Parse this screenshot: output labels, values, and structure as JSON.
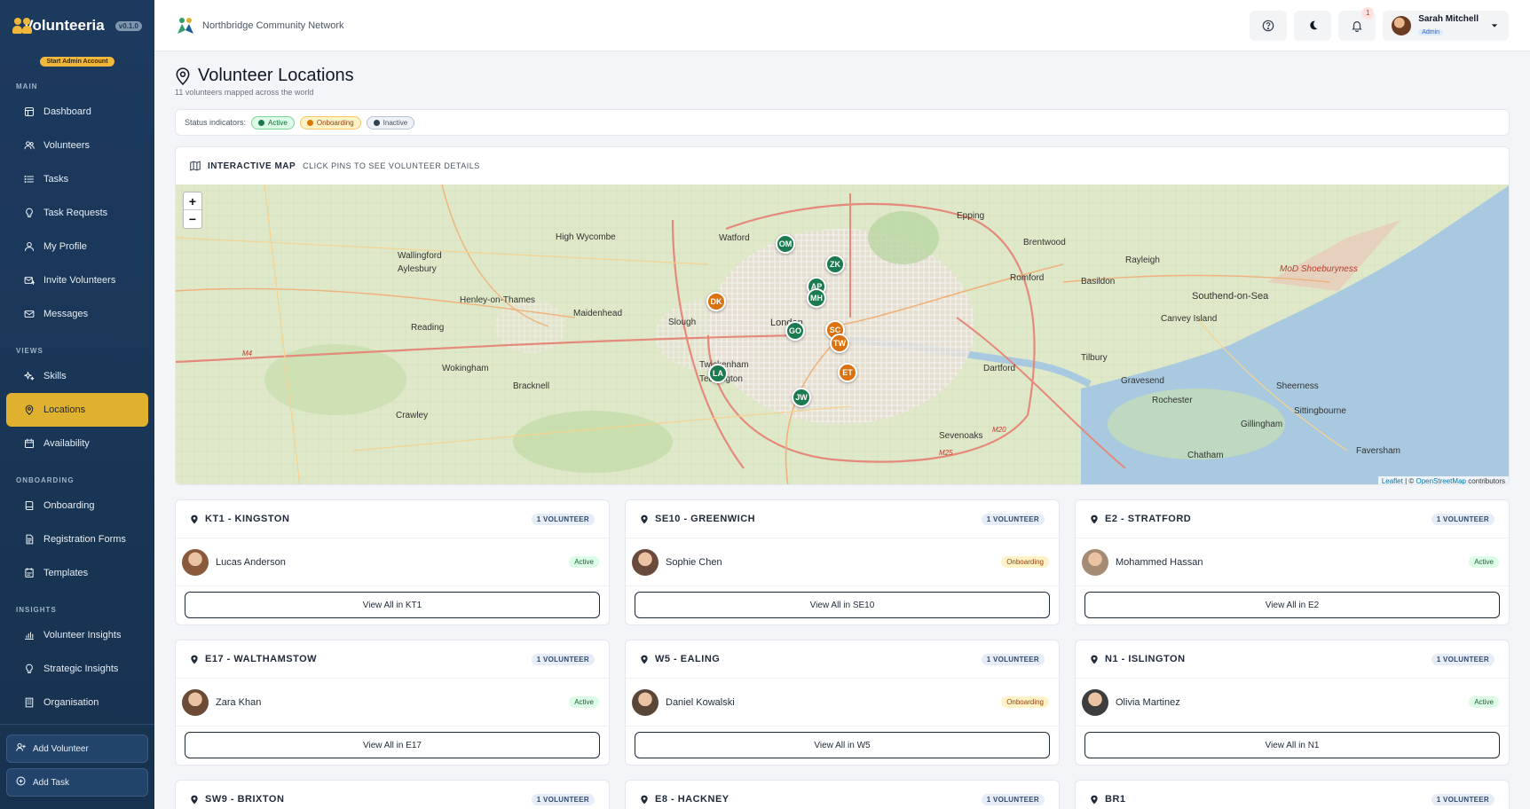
{
  "app": {
    "name": "Volunteeria",
    "version": "v0.1.0",
    "admin_pill": "Start Admin Account",
    "org_name": "Northbridge Community Network"
  },
  "sidebar": {
    "sections": [
      {
        "title": "MAIN",
        "items": [
          {
            "label": "Dashboard",
            "icon": "dashboard-icon"
          },
          {
            "label": "Volunteers",
            "icon": "users-icon"
          },
          {
            "label": "Tasks",
            "icon": "list-icon"
          },
          {
            "label": "Task Requests",
            "icon": "lightbulb-icon"
          },
          {
            "label": "My Profile",
            "icon": "user-icon"
          },
          {
            "label": "Invite Volunteers",
            "icon": "mail-plus-icon"
          },
          {
            "label": "Messages",
            "icon": "mail-icon"
          }
        ]
      },
      {
        "title": "VIEWS",
        "items": [
          {
            "label": "Skills",
            "icon": "sparkle-icon"
          },
          {
            "label": "Locations",
            "icon": "map-pin-icon",
            "active": true
          },
          {
            "label": "Availability",
            "icon": "calendar-icon"
          }
        ]
      },
      {
        "title": "ONBOARDING",
        "items": [
          {
            "label": "Onboarding",
            "icon": "book-icon"
          },
          {
            "label": "Registration Forms",
            "icon": "form-icon"
          },
          {
            "label": "Templates",
            "icon": "template-icon"
          }
        ]
      },
      {
        "title": "INSIGHTS",
        "items": [
          {
            "label": "Volunteer Insights",
            "icon": "bar-chart-icon"
          },
          {
            "label": "Strategic Insights",
            "icon": "lightbulb-icon"
          },
          {
            "label": "Organisation",
            "icon": "building-icon"
          }
        ]
      }
    ],
    "actions": {
      "add_volunteer": "Add Volunteer",
      "add_task": "Add Task"
    }
  },
  "header": {
    "notification_count": "1",
    "user_name": "Sarah Mitchell",
    "user_role": "Admin"
  },
  "page": {
    "title": "Volunteer Locations",
    "subtitle": "11 volunteers mapped across the world",
    "status_label": "Status indicators:",
    "status_legend": [
      "Active",
      "Onboarding",
      "Inactive"
    ],
    "map_title": "INTERACTIVE MAP",
    "map_hint": "CLICK PINS TO SEE VOLUNTEER DETAILS",
    "attribution": {
      "leaflet": "Leaflet",
      "sep": " | © ",
      "osm": "OpenStreetMap",
      "rest": " contributors"
    }
  },
  "map_places": [
    "London",
    "Southend-on-Sea",
    "High Wycombe",
    "Maidenhead",
    "Dartford",
    "Gravesend",
    "Epping",
    "Romford",
    "Basildon",
    "Chatham",
    "Bracknell",
    "Wokingham",
    "Reading",
    "Slough",
    "Watford",
    "Crawley",
    "Sevenoaks",
    "Twickenham",
    "Teddington",
    "Tilbury",
    "Canvey Island",
    "Rochester",
    "Sittingbourne",
    "Faversham",
    "Sheerness",
    "Gillingham",
    "Rayleigh",
    "Brentwood",
    "Aylesbury",
    "Wallingford",
    "Henley-on-Thames"
  ],
  "map_special_labels": {
    "mod": "MoD Shoeburyness",
    "m20": "M20",
    "m25": "M25",
    "m4": "M4"
  },
  "pins": [
    {
      "initials": "OM",
      "status": "active"
    },
    {
      "initials": "ZK",
      "status": "active"
    },
    {
      "initials": "AP",
      "status": "active"
    },
    {
      "initials": "MH",
      "status": "active"
    },
    {
      "initials": "DK",
      "status": "onboarding"
    },
    {
      "initials": "GO",
      "status": "active"
    },
    {
      "initials": "SC",
      "status": "onboarding"
    },
    {
      "initials": "TW",
      "status": "onboarding"
    },
    {
      "initials": "ET",
      "status": "onboarding"
    },
    {
      "initials": "LA",
      "status": "active"
    },
    {
      "initials": "JW",
      "status": "active"
    }
  ],
  "locations": [
    {
      "name": "KT1 - KINGSTON",
      "count": "1 VOLUNTEER",
      "volunteer": "Lucas Anderson",
      "status": "Active",
      "button": "View All in KT1"
    },
    {
      "name": "SE10 - GREENWICH",
      "count": "1 VOLUNTEER",
      "volunteer": "Sophie Chen",
      "status": "Onboarding",
      "button": "View All in SE10"
    },
    {
      "name": "E2 - STRATFORD",
      "count": "1 VOLUNTEER",
      "volunteer": "Mohammed Hassan",
      "status": "Active",
      "button": "View All in E2"
    },
    {
      "name": "E17 - WALTHAMSTOW",
      "count": "1 VOLUNTEER",
      "volunteer": "Zara Khan",
      "status": "Active",
      "button": "View All in E17"
    },
    {
      "name": "W5 - EALING",
      "count": "1 VOLUNTEER",
      "volunteer": "Daniel Kowalski",
      "status": "Onboarding",
      "button": "View All in W5"
    },
    {
      "name": "N1 - ISLINGTON",
      "count": "1 VOLUNTEER",
      "volunteer": "Olivia Martinez",
      "status": "Active",
      "button": "View All in N1"
    },
    {
      "name": "SW9 - BRIXTON",
      "count": "1 VOLUNTEER"
    },
    {
      "name": "E8 - HACKNEY",
      "count": "1 VOLUNTEER"
    },
    {
      "name": "BR1",
      "count": "1 VOLUNTEER"
    }
  ],
  "colors": {
    "sidebar": "#1c3a5e",
    "accent": "#e0b12f",
    "active": "#1b7a4f",
    "onboarding": "#d9720f",
    "sea": "#a9c9e0"
  }
}
